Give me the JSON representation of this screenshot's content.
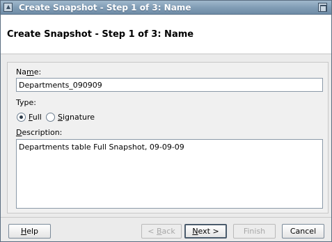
{
  "window": {
    "title": "Create Snapshot - Step 1 of 3: Name"
  },
  "header": {
    "title": "Create Snapshot - Step 1 of 3: Name"
  },
  "form": {
    "name_label_pre": "Na",
    "name_label_mnemonic": "m",
    "name_label_post": "e:",
    "name_value": "Departments_090909",
    "type_label": "Type:",
    "type_options": [
      {
        "pre": "",
        "mnemonic": "F",
        "post": "ull",
        "selected": true
      },
      {
        "pre": "",
        "mnemonic": "S",
        "post": "ignature",
        "selected": false
      }
    ],
    "description_label_pre": "",
    "description_label_mnemonic": "D",
    "description_label_post": "escription:",
    "description_value": "Departments table Full Snapshot, 09-09-09"
  },
  "buttons": {
    "help": {
      "pre": "",
      "mnemonic": "H",
      "post": "elp"
    },
    "back": {
      "pre": "< ",
      "mnemonic": "B",
      "post": "ack",
      "disabled": true
    },
    "next": {
      "pre": "",
      "mnemonic": "N",
      "post": "ext >",
      "default": true
    },
    "finish": {
      "label": "Finish",
      "disabled": true
    },
    "cancel": {
      "label": "Cancel"
    }
  },
  "colors": {
    "titlebar": "#7f9bb4",
    "panel": "#f0f0f0",
    "window_bg": "#ebebeb"
  }
}
